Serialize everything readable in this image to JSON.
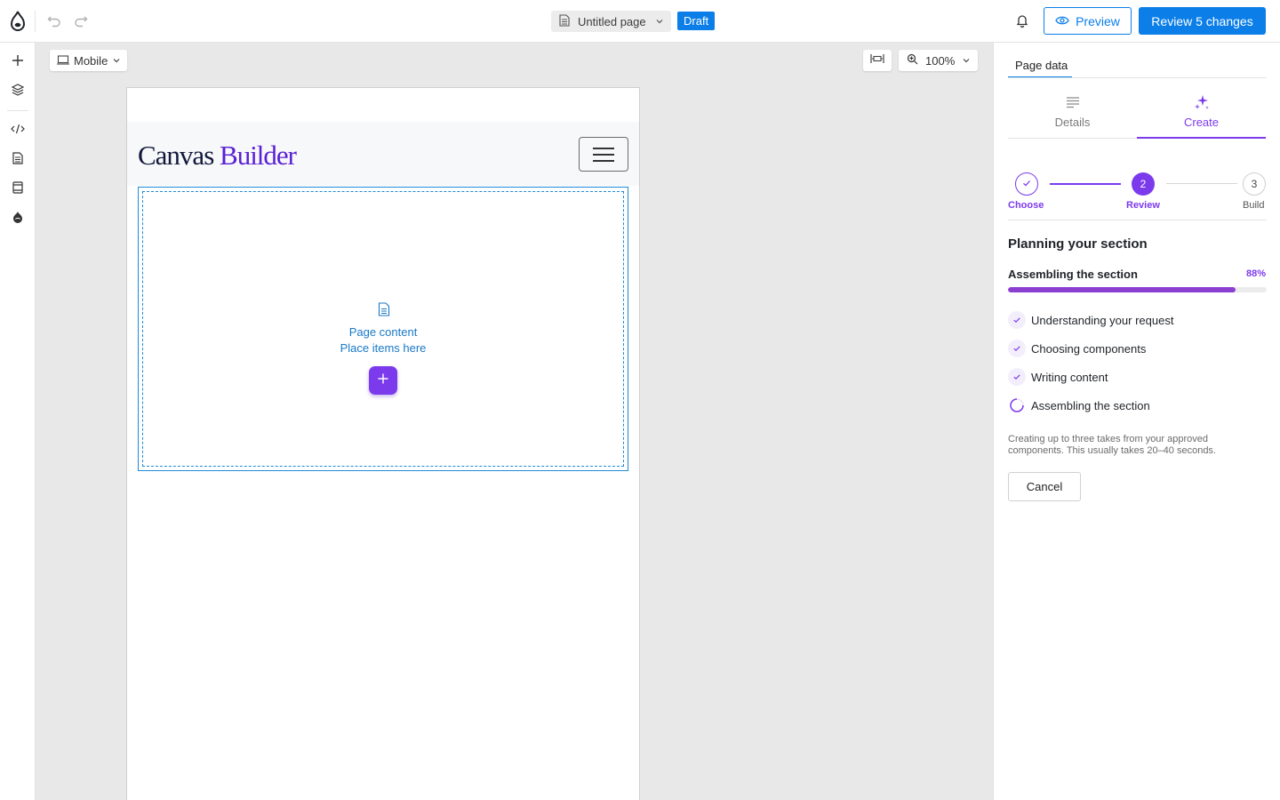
{
  "topbar": {
    "page_name": "Untitled page",
    "status_badge": "Draft",
    "preview_label": "Preview",
    "review_label": "Review 5 changes"
  },
  "canvas": {
    "viewport_label": "Mobile",
    "zoom_label": "100%",
    "site": {
      "brand_part1": "Canvas",
      "brand_part2": "Builder"
    },
    "slot": {
      "title": "Page content",
      "subtitle": "Place items here"
    }
  },
  "panel": {
    "tab_label": "Page data",
    "subtabs": [
      {
        "label": "Details",
        "icon": "text-lines-icon"
      },
      {
        "label": "Create",
        "icon": "sparkle-icon"
      }
    ],
    "steps": [
      {
        "number": "1",
        "label": "Choose",
        "state": "done"
      },
      {
        "number": "2",
        "label": "Review",
        "state": "active"
      },
      {
        "number": "3",
        "label": "Build",
        "state": "pending"
      }
    ],
    "section_title": "Planning your section",
    "progress": {
      "label": "Assembling the section",
      "percent_text": "88%",
      "value": 0.88
    },
    "tasks": [
      {
        "label": "Understanding your request",
        "state": "done"
      },
      {
        "label": "Choosing components",
        "state": "done"
      },
      {
        "label": "Writing content",
        "state": "done"
      },
      {
        "label": "Assembling the section",
        "state": "in-progress"
      }
    ],
    "note": "Creating up to three takes from your approved components. This usually takes 20–40 seconds.",
    "cancel_label": "Cancel"
  },
  "colors": {
    "accent_blue": "#0b7ee8",
    "accent_purple": "#7c3aed",
    "brand_dark": "#12183a"
  }
}
